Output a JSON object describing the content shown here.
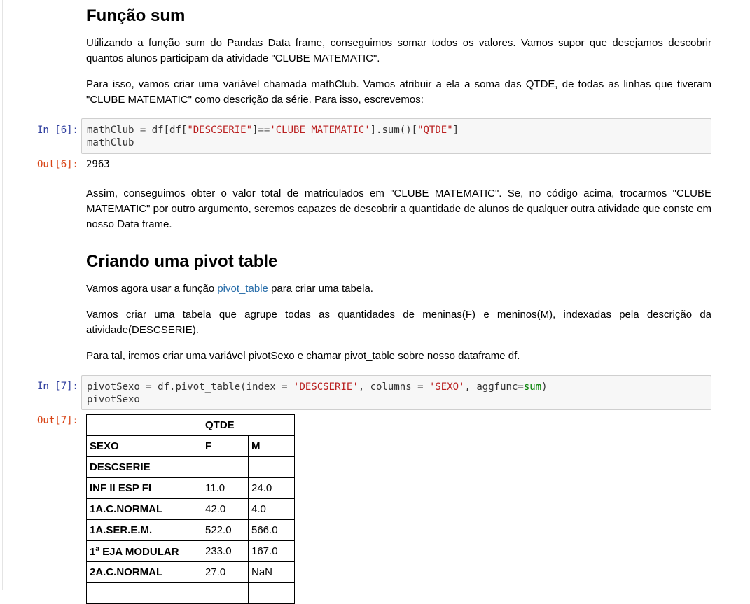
{
  "section1": {
    "heading": "Função sum",
    "p1": "Utilizando a função sum do Pandas Data frame, conseguimos somar todos os valores. Vamos supor que desejamos descobrir quantos alunos participam da atividade \"CLUBE MATEMATIC\".",
    "p2": "Para isso, vamos criar uma variável chamada mathClub. Vamos atribuir a ela a soma das QTDE, de todas as linhas que tiveram \"CLUBE MATEMATIC\" como descrição da série. Para isso, escrevemos:"
  },
  "cell6": {
    "in_prompt": "In [6]:",
    "out_prompt": "Out[6]:",
    "code": {
      "a": "mathClub ",
      "b": "=",
      "c": " df[df[",
      "d": "\"DESCSERIE\"",
      "e": "]",
      "f": "==",
      "g": "'CLUBE MATEMATIC'",
      "h": "].sum()[",
      "i": "\"QTDE\"",
      "j": "]",
      "line2": "mathClub"
    },
    "output": "2963"
  },
  "after6": "Assim, conseguimos obter o valor total de matriculados em \"CLUBE MATEMATIC\". Se, no código acima, trocarmos \"CLUBE MATEMATIC\" por outro argumento, seremos capazes de descobrir a quantidade de alunos de qualquer outra atividade que conste em nosso Data frame.",
  "section2": {
    "heading": "Criando uma pivot table",
    "p1_pre": "Vamos agora usar a função ",
    "p1_link": "pivot_table",
    "p1_post": " para criar uma tabela.",
    "p2": "Vamos criar uma tabela que agrupe todas as quantidades de meninas(F) e meninos(M), indexadas pela descrição da atividade(DESCSERIE).",
    "p3": "Para tal, iremos criar uma variável pivotSexo e chamar pivot_table sobre nosso dataframe df."
  },
  "cell7": {
    "in_prompt": "In [7]:",
    "out_prompt": "Out[7]:",
    "code": {
      "a": "pivotSexo ",
      "b": "=",
      "c": " df.pivot_table(index ",
      "d": "=",
      "e": " ",
      "f": "'DESCSERIE'",
      "g": ", columns ",
      "h": "=",
      "i": " ",
      "j": "'SEXO'",
      "k": ", aggfunc",
      "l": "=",
      "m": "sum",
      "n": ")",
      "line2": "pivotSexo"
    }
  },
  "pivot_table": {
    "top_header": "QTDE",
    "sexo_label": "SEXO",
    "col_f": "F",
    "col_m": "M",
    "index_name": "DESCSERIE",
    "rows": [
      {
        "label": "INF II ESP FI",
        "f": "11.0",
        "m": "24.0"
      },
      {
        "label": "1A.C.NORMAL",
        "f": "42.0",
        "m": "4.0"
      },
      {
        "label": "1A.SER.E.M.",
        "f": "522.0",
        "m": "566.0"
      },
      {
        "label_pre": "1",
        "label_sup": "a",
        "label_post": " EJA MODULAR",
        "f": "233.0",
        "m": "167.0"
      },
      {
        "label": "2A.C.NORMAL",
        "f": "27.0",
        "m": "NaN"
      }
    ]
  }
}
